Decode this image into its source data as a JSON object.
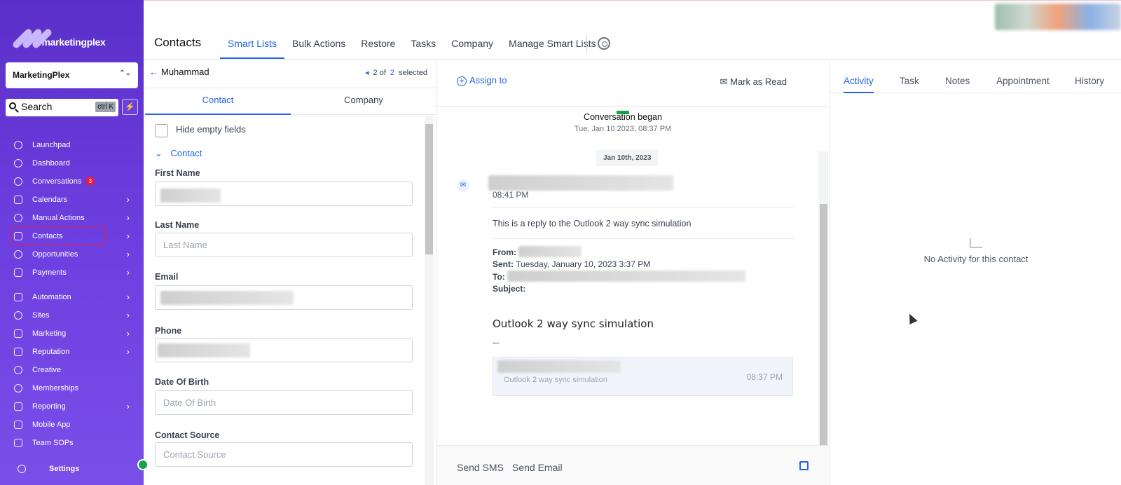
{
  "sidebar": {
    "brand": "marketingplex",
    "account": "MarketingPlex",
    "search": {
      "label": "Search",
      "shortcut": "ctrl K"
    },
    "items": [
      {
        "label": "Launchpad",
        "icon": "rocket-icon"
      },
      {
        "label": "Dashboard",
        "icon": "gauge-icon"
      },
      {
        "label": "Conversations",
        "icon": "chat-icon",
        "badge": "3"
      },
      {
        "label": "Calendars",
        "icon": "calendar-icon",
        "arrow": true
      },
      {
        "label": "Manual Actions",
        "icon": "check-circle-icon",
        "arrow": true
      },
      {
        "label": "Contacts",
        "icon": "contacts-icon",
        "arrow": true,
        "selected": true
      },
      {
        "label": "Opportunities",
        "icon": "flame-icon",
        "arrow": true
      },
      {
        "label": "Payments",
        "icon": "card-icon",
        "arrow": true
      },
      {
        "label": "Automation",
        "icon": "wand-icon",
        "arrow": true
      },
      {
        "label": "Sites",
        "icon": "globe-icon",
        "arrow": true
      },
      {
        "label": "Marketing",
        "icon": "send-icon",
        "arrow": true
      },
      {
        "label": "Reputation",
        "icon": "star-icon",
        "arrow": true
      },
      {
        "label": "Creative",
        "icon": "palette-icon"
      },
      {
        "label": "Memberships",
        "icon": "award-icon"
      },
      {
        "label": "Reporting",
        "icon": "chart-icon",
        "arrow": true
      },
      {
        "label": "Mobile App",
        "icon": "phone-icon"
      },
      {
        "label": "Team SOPs",
        "icon": "list-icon"
      }
    ],
    "settings": "Settings"
  },
  "header": {
    "title": "Contacts",
    "tabs": [
      "Smart Lists",
      "Bulk Actions",
      "Restore",
      "Tasks",
      "Company",
      "Manage Smart Lists"
    ],
    "active_tab": "Smart Lists"
  },
  "contact_panel": {
    "back_name": "Muhammad",
    "pager": {
      "current": "2 of",
      "total": "2",
      "suffix": "selected"
    },
    "tabs": {
      "contact": "Contact",
      "company": "Company"
    },
    "hide_empty": "Hide empty fields",
    "section": "Contact",
    "fields": {
      "first_name": {
        "label": "First Name"
      },
      "last_name": {
        "label": "Last Name",
        "placeholder": "Last Name"
      },
      "email": {
        "label": "Email"
      },
      "phone": {
        "label": "Phone"
      },
      "dob": {
        "label": "Date Of Birth",
        "placeholder": "Date Of Birth"
      },
      "source": {
        "label": "Contact Source",
        "placeholder": "Contact Source"
      }
    }
  },
  "conversation": {
    "assign": "Assign to",
    "mark_read": "Mark as Read",
    "began": "Conversation began",
    "began_time": "Tue, Jan 10 2023, 08:37 PM",
    "date_pill": "Jan 10th, 2023",
    "msg_time": "08:41 PM",
    "reply_text": "This is a reply to the Outlook 2 way sync simulation",
    "from_label": "From:",
    "sent_label": "Sent:",
    "sent_value": "Tuesday, January 10, 2023 3:37 PM",
    "to_label": "To:",
    "subject_label": "Subject:",
    "subject_heading": "Outlook 2 way sync simulation",
    "ellipsis": "•••",
    "quoted_text": "Outlook 2 way sync simulation",
    "quoted_time": "08:37 PM",
    "footer": {
      "sms": "Send SMS",
      "email": "Send Email"
    }
  },
  "activity_panel": {
    "tabs": [
      "Activity",
      "Task",
      "Notes",
      "Appointment",
      "History"
    ],
    "active_tab": "Activity",
    "empty": "No Activity for this contact"
  }
}
